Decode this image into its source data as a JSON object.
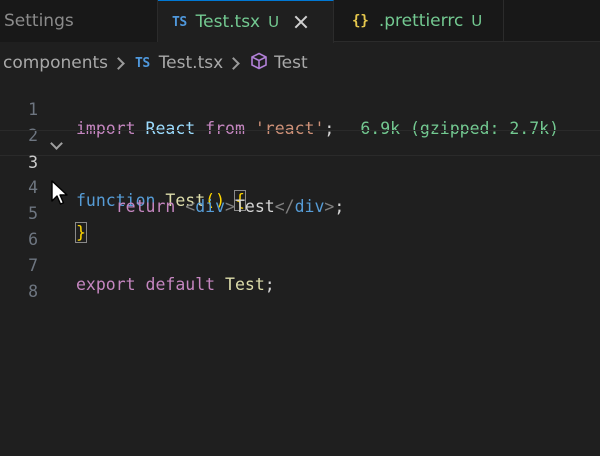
{
  "tabs": [
    {
      "label": "Settings",
      "status": ""
    },
    {
      "label": "Test.tsx",
      "status": "U",
      "badge": "TS"
    },
    {
      "label": ".prettierrc",
      "status": "U",
      "badge": "{}"
    }
  ],
  "breadcrumb": {
    "folder": "components",
    "file_badge": "TS",
    "file": "Test.tsx",
    "symbol": "Test"
  },
  "editor": {
    "line_numbers": [
      "1",
      "2",
      "3",
      "4",
      "5",
      "6",
      "7",
      "8"
    ],
    "line1": {
      "kw_import": "import",
      "name": "React",
      "kw_from": "from",
      "str": "'react'",
      "semi": ";",
      "size_hint": "6.9k (gzipped: 2.7k)"
    },
    "line3": {
      "kw": "function",
      "name": "Test",
      "parens": "()",
      "brace": "{"
    },
    "line4": {
      "kw": "return",
      "lt1": "<",
      "tag1": "div",
      "gt1": ">",
      "text": "Test",
      "lt2": "</",
      "tag2": "div",
      "gt2": ">",
      "semi": ";"
    },
    "line5": {
      "brace": "}"
    },
    "line7": {
      "kw1": "export",
      "kw2": "default",
      "name": "Test",
      "semi": ";"
    }
  }
}
